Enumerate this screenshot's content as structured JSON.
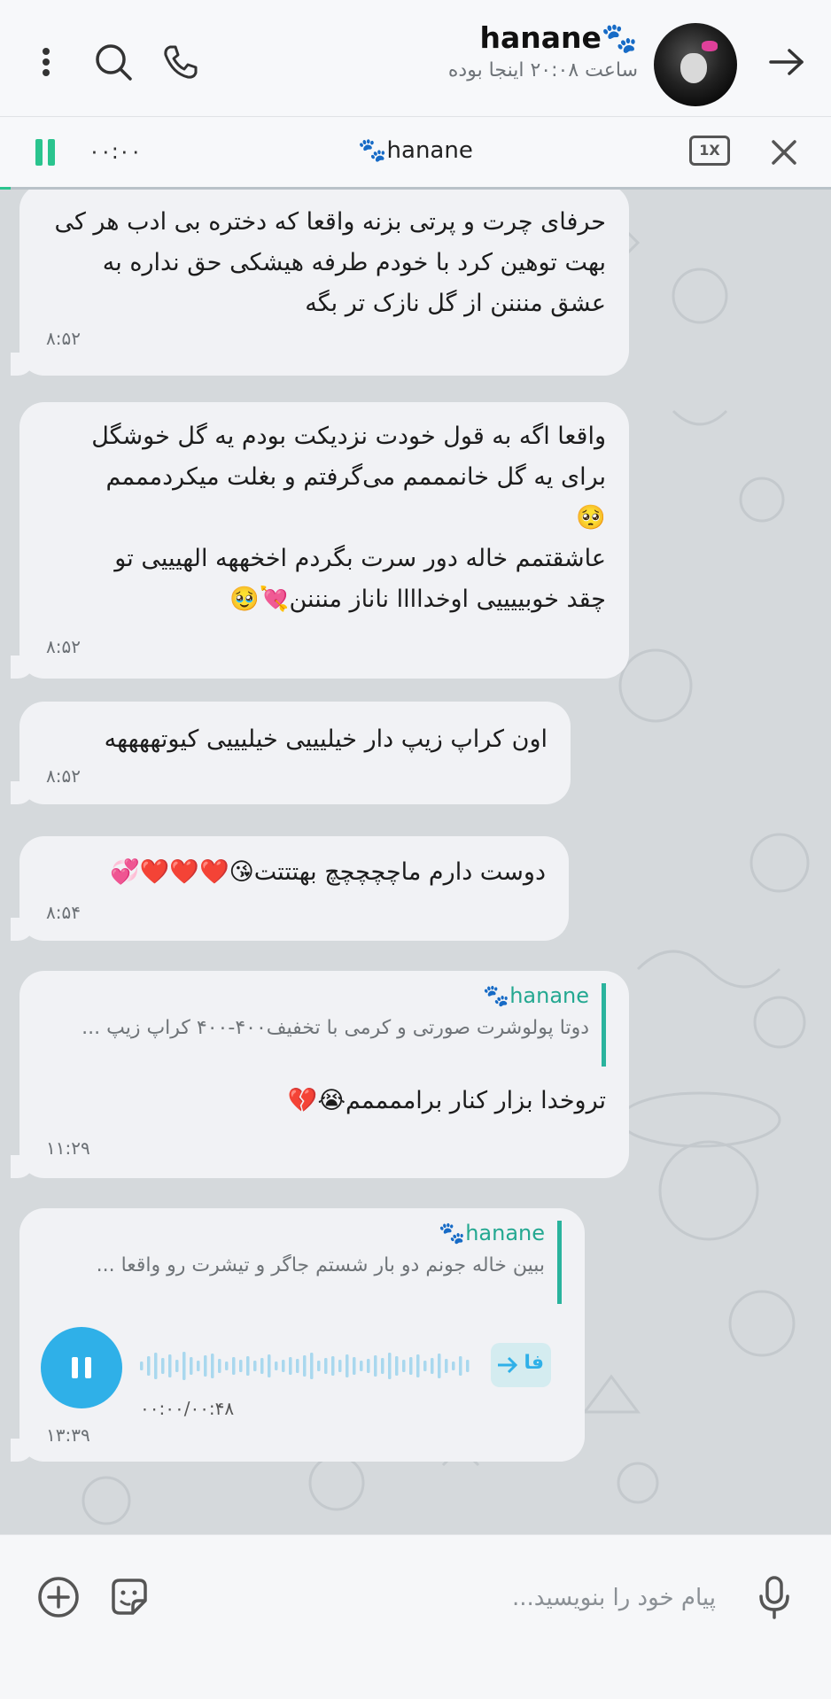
{
  "header": {
    "contact_name": "🐾hanane",
    "last_seen": "ساعت ۲۰:۰۸ اینجا بوده"
  },
  "audio_player": {
    "elapsed": "۰۰:۰۰",
    "title": "🐾hanane",
    "speed": "1X",
    "progress": 0.013
  },
  "messages": [
    {
      "lines": [
        "حرفای چرت و پرتی بزنه واقعا که دختره بی ادب هر کی",
        "بهت توهین کرد با خودم طرفه هیشکی حق نداره به",
        "عشق منننن از گل نازک تر بگه"
      ],
      "time": "۸:۵۲"
    },
    {
      "lines": [
        "واقعا اگه به قول خودت نزدیکت بودم یه گل خوشگل",
        "برای یه گل خانمممم می‌گرفتم و بغلت میکردمممم",
        "🥺",
        "عاشقتمم خاله دور سرت بگردم اخخههه الهیییی تو",
        "چقد خوبییییی اوخداااا ناناز منننن💘🥹"
      ],
      "time": "۸:۵۲"
    },
    {
      "lines": [
        "اون کراپ زیپ دار خیلیییی خیلیییی کیوتههههه"
      ],
      "time": "۸:۵۲"
    },
    {
      "lines": [
        "دوست دارم ماچچچچچ بهتتتت😘❤️❤️❤️💞"
      ],
      "time": "۸:۵۴"
    },
    {
      "reply_name": "hanane🐾",
      "reply_text": "دوتا پولوشرت صورتی و کرمی با تخفیف۴۰۰-۴۰۰ کراپ زیپ ...",
      "lines": [
        "تروخدا بزار کنار براممممم😭💔"
      ],
      "time": "۱۱:۲۹"
    }
  ],
  "voice_message": {
    "reply_name": "hanane🐾",
    "reply_text": "ببین خاله جونم دو بار شستم جاگر و تیشرت رو واقعا ...",
    "transcribe_label": "فا",
    "duration": "۰۰:۰۰/۰۰:۴۸",
    "time": "۱۳:۳۹"
  },
  "input": {
    "placeholder": "پیام خود را بنویسید..."
  },
  "colors": {
    "accent_green": "#2ac48e",
    "voice_blue": "#2fb0e8",
    "reply_teal": "#24a891"
  }
}
